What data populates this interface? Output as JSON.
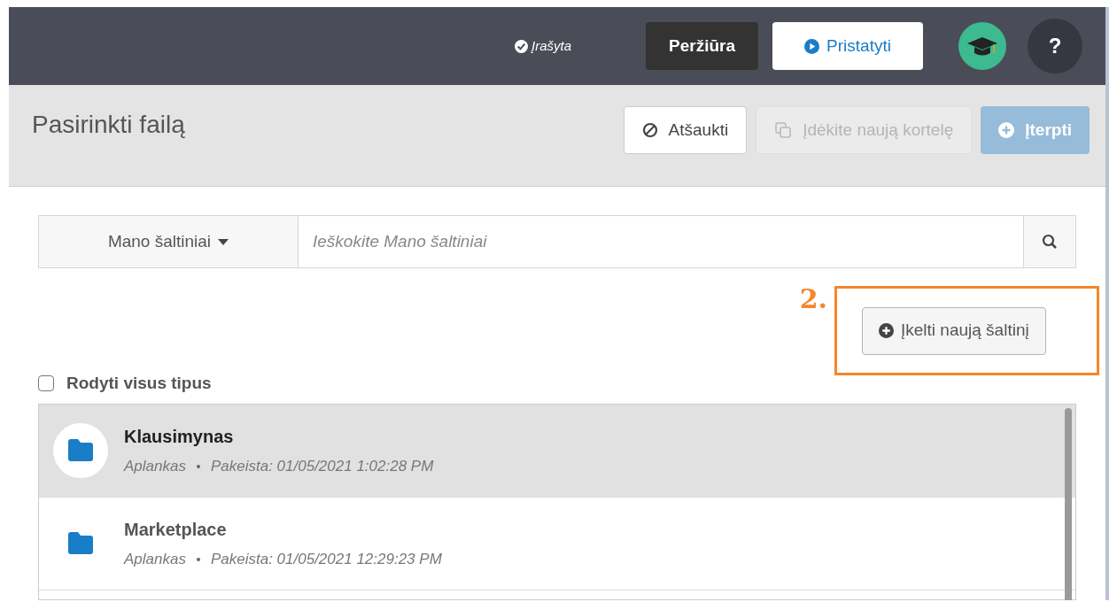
{
  "top_bar": {
    "save_status": "Įrašyta",
    "preview_button": "Peržiūra",
    "present_button": "Pristatyti",
    "help_button": "?"
  },
  "dialog": {
    "title": "Pasirinkti failą",
    "buttons": [
      {
        "label": "Atšaukti",
        "kind": "cancel",
        "disabled": false
      },
      {
        "label": "Įdėkite naują kortelę",
        "kind": "card",
        "disabled": true
      },
      {
        "label": "Įterpti",
        "kind": "insert",
        "disabled": true
      }
    ]
  },
  "search": {
    "source_dropdown": "Mano šaltiniai",
    "placeholder": "Ieškokite Mano šaltiniai"
  },
  "annotation": {
    "step": "2."
  },
  "upload_button": "Įkelti naują šaltinį",
  "show_all_types": {
    "label": "Rodyti visus tipus",
    "checked": false
  },
  "files": [
    {
      "name": "Klausimynas",
      "type": "Aplankas",
      "modified": "Pakeista: 01/05/2021 1:02:28 PM",
      "selected": true
    },
    {
      "name": "Marketplace",
      "type": "Aplankas",
      "modified": "Pakeista: 01/05/2021 12:29:23 PM",
      "selected": false
    }
  ]
}
